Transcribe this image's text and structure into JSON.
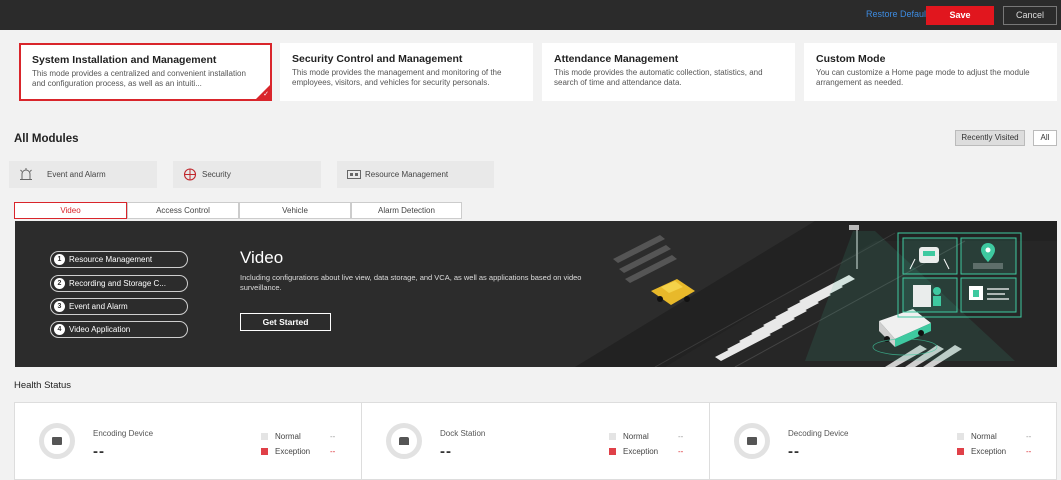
{
  "toolbar": {
    "restore_label": "Restore Default",
    "save_label": "Save",
    "cancel_label": "Cancel"
  },
  "modes": [
    {
      "title": "System Installation and Management",
      "desc": "This mode provides a centralized and convenient installation and configuration process, as well as an intuiti...",
      "selected": true
    },
    {
      "title": "Security Control and Management",
      "desc": "This mode provides the management and monitoring of the employees, visitors, and vehicles for security personals."
    },
    {
      "title": "Attendance Management",
      "desc": "This mode provides the automatic collection, statistics, and search of time and attendance data."
    },
    {
      "title": "Custom Mode",
      "desc": "You can customize a Home page mode to adjust the module arrangement as needed."
    }
  ],
  "modules": {
    "title": "All Modules",
    "recently_visited_label": "Recently Visited",
    "all_label": "All"
  },
  "categories": [
    {
      "label": "Event and Alarm",
      "icon": "alarm-icon"
    },
    {
      "label": "Security",
      "icon": "shield-icon"
    },
    {
      "label": "Resource Management",
      "icon": "resource-icon"
    }
  ],
  "tabs": [
    "Video",
    "Access Control",
    "Vehicle",
    "Alarm Detection"
  ],
  "banner": {
    "steps": [
      {
        "num": "1",
        "label": "Resource Management"
      },
      {
        "num": "2",
        "label": "Recording and Storage C..."
      },
      {
        "num": "3",
        "label": "Event and Alarm"
      },
      {
        "num": "4",
        "label": "Video Application"
      }
    ],
    "title": "Video",
    "desc": "Including configurations about live view, data storage, and VCA, as well as applications based on video surveillance.",
    "button_label": "Get Started"
  },
  "health": {
    "title": "Health Status",
    "cards": [
      {
        "name": "Encoding Device",
        "value": "--",
        "normal_label": "Normal",
        "normal_value": "--",
        "exception_label": "Exception",
        "exception_value": "--"
      },
      {
        "name": "Dock Station",
        "value": "--",
        "normal_label": "Normal",
        "normal_value": "--",
        "exception_label": "Exception",
        "exception_value": "--"
      },
      {
        "name": "Decoding Device",
        "value": "--",
        "normal_label": "Normal",
        "normal_value": "--",
        "exception_label": "Exception",
        "exception_value": "--"
      }
    ]
  },
  "colors": {
    "accent": "#d9252b",
    "link": "#3d8be0",
    "topbar": "#2b2b2b",
    "banner": "#2c2c2c",
    "teal": "#3ec9a0"
  }
}
